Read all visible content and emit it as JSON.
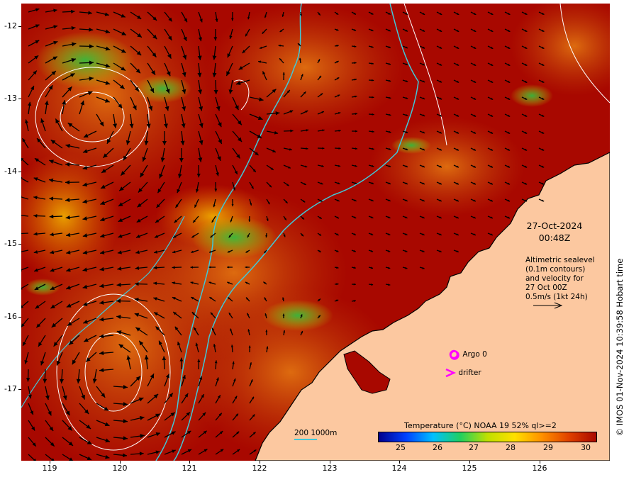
{
  "overlay": {
    "date": "27-Oct-2024",
    "time": "00:48Z",
    "note_lines": [
      "Altimetric sealevel",
      "(0.1m contours)",
      "and velocity for",
      "27 Oct 00Z",
      "0.5m/s (1kt 24h)"
    ]
  },
  "legend": {
    "argo": "Argo 0",
    "drifter": "drifter",
    "isobath": "200  1000m"
  },
  "colorbar": {
    "title": "Temperature (°C) NOAA 19 52% ql>=2",
    "ticks": [
      "25",
      "26",
      "27",
      "28",
      "29",
      "30"
    ],
    "colors": [
      "#00008c",
      "#0040ff",
      "#00c0ff",
      "#20d060",
      "#c0e000",
      "#ffe000",
      "#ff9000",
      "#e04000",
      "#a80800"
    ]
  },
  "copyright": "© IMOS 01-Nov-2024 10:39:58 Hobart time",
  "axes": {
    "x_ticks": [
      "119",
      "120",
      "121",
      "122",
      "123",
      "124",
      "125",
      "126"
    ],
    "y_ticks": [
      "-12",
      "-13",
      "-14",
      "-15",
      "-16",
      "-17"
    ]
  },
  "colors": {
    "land": "#fcc8a0",
    "warm_sst": "#a80800",
    "isobath": "#40c8d8",
    "argo_marker": "#ff00ff"
  }
}
